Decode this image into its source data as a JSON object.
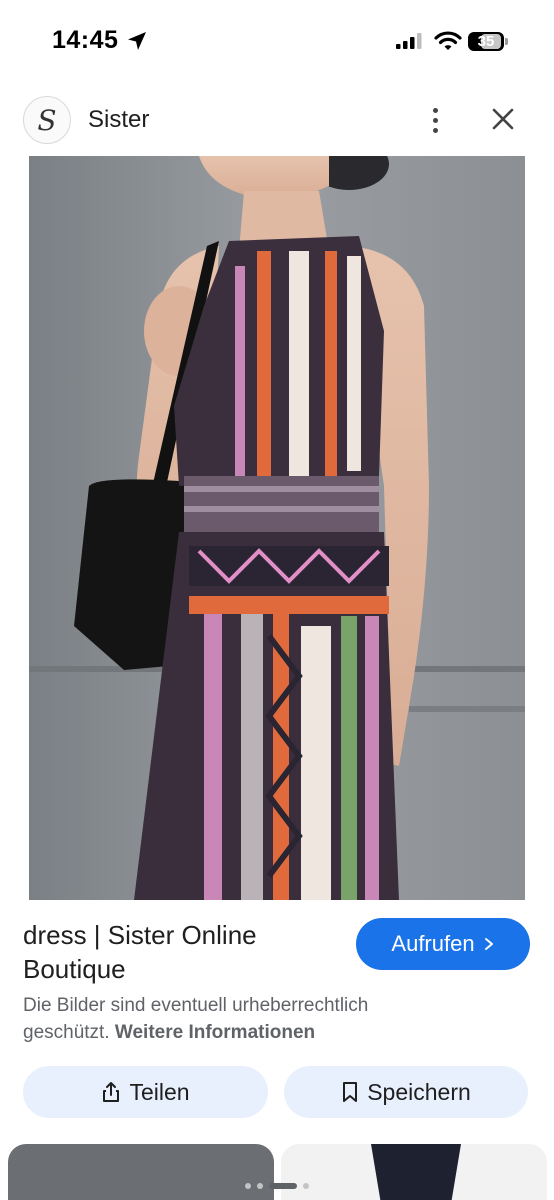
{
  "status_bar": {
    "time": "14:45",
    "battery_level": "35"
  },
  "header": {
    "site_logo_letter": "S",
    "site_name": "Sister"
  },
  "image": {
    "description_icon": "product-photo"
  },
  "result": {
    "title": "dress | Sister Online Boutique",
    "visit_label": "Aufrufen",
    "copyright_text": "Die Bilder sind eventuell urheberrechtlich geschützt.",
    "more_info_label": "Weitere Informationen"
  },
  "actions": {
    "share_label": "Teilen",
    "save_label": "Speichern"
  },
  "colors": {
    "accent": "#1a73e8",
    "button_bg": "#e8f0fe"
  }
}
